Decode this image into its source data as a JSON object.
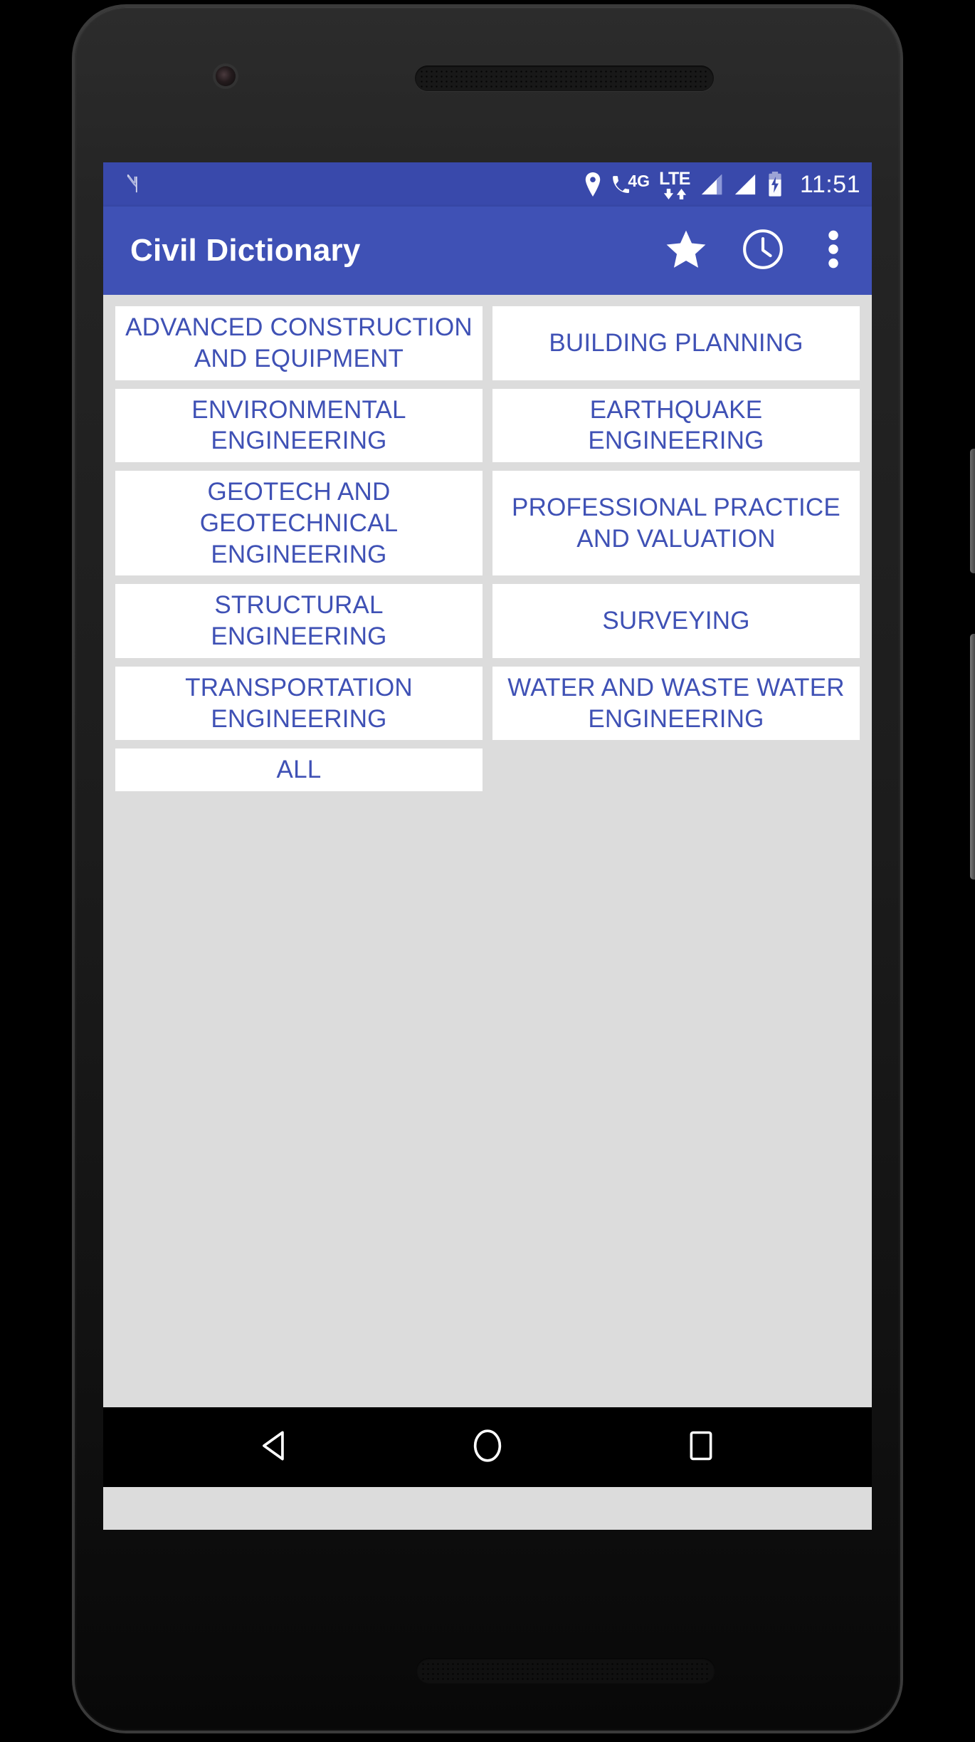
{
  "device": {
    "frame": "android-phone",
    "parts": {
      "front_camera": "front-camera",
      "earpiece": "earpiece-speaker",
      "bottom_speaker": "bottom-speaker",
      "power_button": "power-button",
      "volume_rocker": "volume-rocker"
    }
  },
  "status_bar": {
    "background_color": "#3949ab",
    "nfc_logo": "nfc-n-logo",
    "icons": [
      {
        "name": "location-icon",
        "label": "location"
      },
      {
        "name": "mobile-data-4g-icon",
        "label": "4G"
      },
      {
        "name": "lte-data-transfer-icon",
        "label": "LTE"
      },
      {
        "name": "signal-bars-sim1-icon",
        "label": "signal 1"
      },
      {
        "name": "signal-bars-sim2-icon",
        "label": "signal 2"
      },
      {
        "name": "battery-charging-icon",
        "label": "battery charging"
      }
    ],
    "data_label_4g": "4G",
    "data_label_lte": "LTE",
    "clock": "11:51"
  },
  "app_bar": {
    "title": "Civil Dictionary",
    "background_color": "#3f51b5",
    "actions": [
      {
        "name": "favorites-button",
        "icon": "star-icon",
        "label": "Favorites"
      },
      {
        "name": "history-button",
        "icon": "clock-icon",
        "label": "History"
      },
      {
        "name": "overflow-menu-button",
        "icon": "more-vert-icon",
        "label": "More options"
      }
    ]
  },
  "content": {
    "background_color": "#dcdcdc",
    "tile_background": "#ffffff",
    "tile_text_color": "#3f51b5",
    "categories": [
      "ADVANCED CONSTRUCTION AND EQUIPMENT",
      "BUILDING PLANNING",
      "ENVIRONMENTAL ENGINEERING",
      "EARTHQUAKE ENGINEERING",
      "GEOTECH AND GEOTECHNICAL ENGINEERING",
      "PROFESSIONAL PRACTICE AND VALUATION",
      "STRUCTURAL ENGINEERING",
      "SURVEYING",
      "TRANSPORTATION ENGINEERING",
      "WATER AND WASTE WATER ENGINEERING",
      "ALL"
    ]
  },
  "nav_bar": {
    "background_color": "#000000",
    "buttons": [
      {
        "name": "nav-back-button",
        "icon": "back-triangle-icon",
        "label": "Back"
      },
      {
        "name": "nav-home-button",
        "icon": "home-circle-icon",
        "label": "Home"
      },
      {
        "name": "nav-recents-button",
        "icon": "recents-square-icon",
        "label": "Recents"
      }
    ]
  }
}
